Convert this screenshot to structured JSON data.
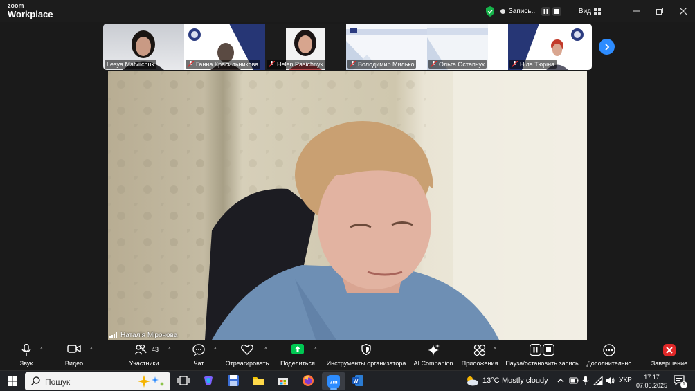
{
  "app": {
    "logo_top": "zoom",
    "logo_bottom": "Workplace"
  },
  "titlebar": {
    "recording": "Запись...",
    "view": "Вид"
  },
  "participants": [
    {
      "name": "Lesya Matviichuk",
      "muted": false
    },
    {
      "name": "Ганна Красильникова",
      "muted": true
    },
    {
      "name": "Helen Pasichnyk",
      "muted": true
    },
    {
      "name": "Володимир Милько",
      "muted": true
    },
    {
      "name": "Ольга Остапчук",
      "muted": true
    },
    {
      "name": "Ніла Тюріна",
      "muted": true
    }
  ],
  "main_video": {
    "speaker": "Наталія Міронова"
  },
  "toolbar": {
    "audio": "Звук",
    "video": "Видео",
    "participants": "Участники",
    "participants_count": "43",
    "chat": "Чат",
    "react": "Отреагировать",
    "share": "Поделиться",
    "host_tools": "Инструменты организатора",
    "ai_companion": "AI Companion",
    "apps": "Приложения",
    "pause_stop_rec": "Пауза/остановить запись",
    "more": "Дополнительно",
    "end": "Завершение"
  },
  "taskbar": {
    "search_placeholder": "Пошук",
    "weather_temp": "13°C",
    "weather_desc": "Mostly cloudy",
    "language": "УКР",
    "time": "17:17",
    "date": "07.05.2025",
    "notification_count": "1"
  },
  "colors": {
    "accent": "#2d8cff",
    "share": "#00c853",
    "end": "#e02828",
    "secure": "#16b34a"
  }
}
